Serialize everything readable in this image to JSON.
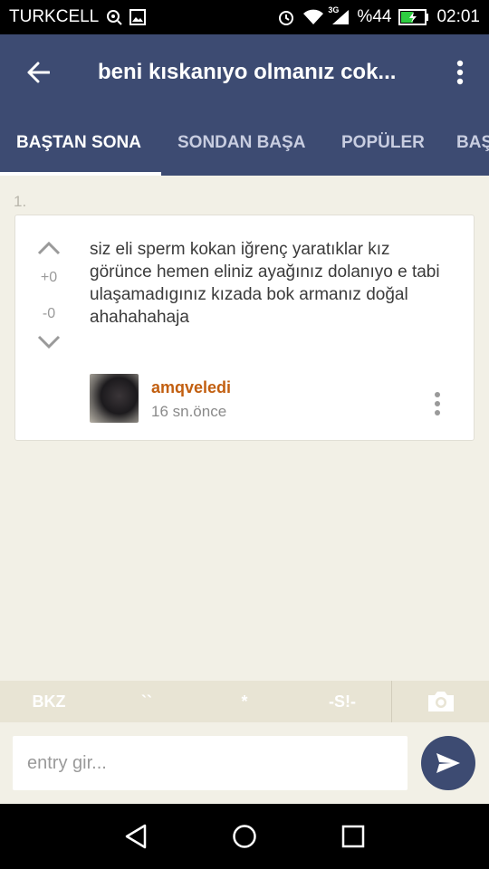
{
  "status_bar": {
    "carrier": "TURKCELL",
    "network": "3G",
    "battery": "%44",
    "time": "02:01"
  },
  "app_bar": {
    "title": "beni kıskanıyo olmanız cok...",
    "back_icon": "arrow-left-icon",
    "overflow_icon": "more-vertical-icon"
  },
  "tabs": [
    {
      "label": "BAŞTAN SONA",
      "active": true
    },
    {
      "label": "SONDAN BAŞA",
      "active": false
    },
    {
      "label": "POPÜLER",
      "active": false
    },
    {
      "label": "BAŞ",
      "active": false
    }
  ],
  "entry": {
    "index": "1.",
    "score_plus": "+0",
    "score_minus": "-0",
    "text": "siz eli sperm kokan iğrenç yaratıklar kız görünce hemen eliniz ayağınız dolanıyo e tabi ulaşamadıgınız kızada bok armanız doğal ahahahahaja",
    "author": "amqveledi",
    "time_ago": "16 sn.önce"
  },
  "editor_bar": {
    "buttons": [
      "BKZ",
      "``",
      "*",
      "-S!-"
    ],
    "camera_icon": "camera-icon"
  },
  "input": {
    "placeholder": "entry gir...",
    "value": ""
  },
  "colors": {
    "primary": "#3d4b72",
    "background": "#f2f0e6",
    "author": "#c25f10"
  }
}
